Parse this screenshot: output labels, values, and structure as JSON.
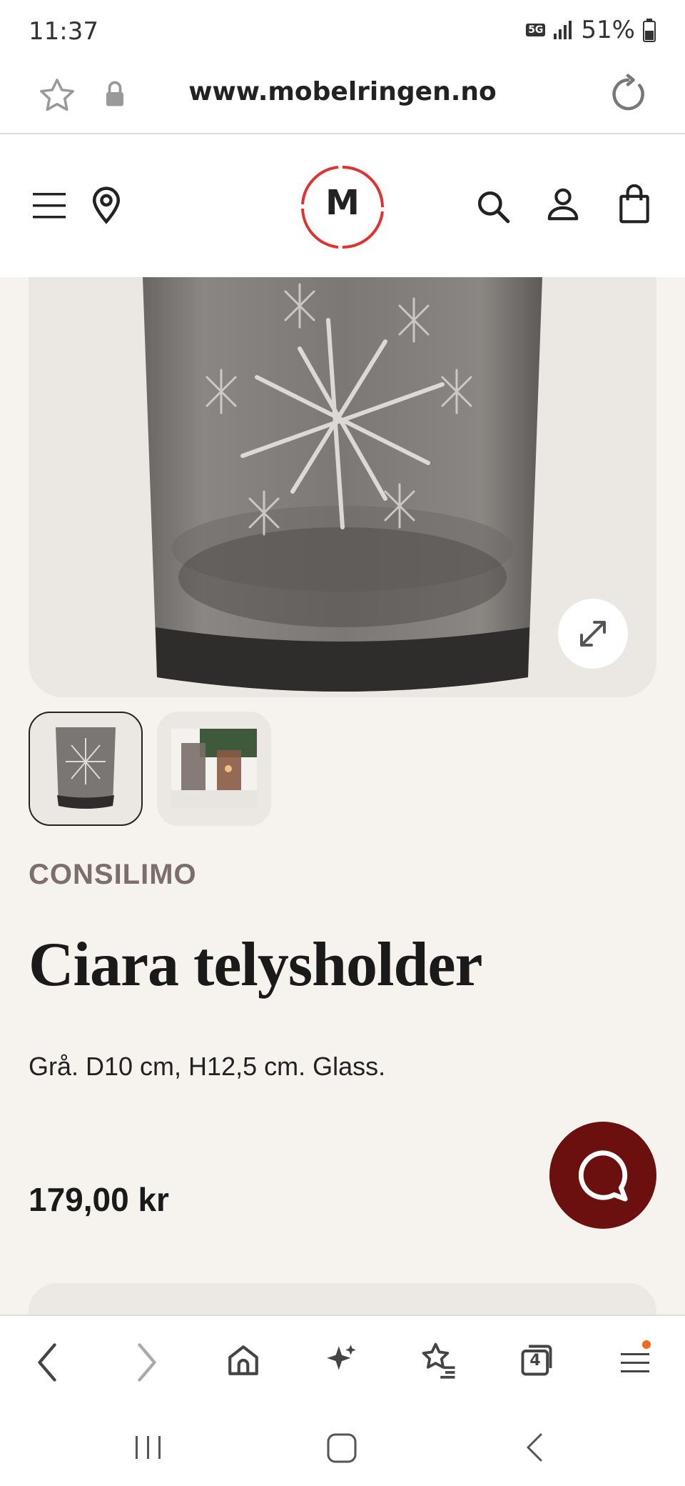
{
  "status": {
    "time": "11:37",
    "network": "5G",
    "battery": "51%"
  },
  "browser": {
    "url": "www.mobelringen.no",
    "tab_count": "4"
  },
  "header": {
    "logo_letter": "M"
  },
  "product": {
    "brand": "CONSILIMO",
    "title": "Ciara telysholder",
    "description": "Grå. D10 cm, H12,5 cm. Glass.",
    "price": "179,00 kr"
  },
  "colors": {
    "accent": "#e0322f",
    "chat": "#6b0f0f",
    "background": "#f6f2ee"
  },
  "icons": [
    "star-icon",
    "lock-icon",
    "reload-icon",
    "menu-icon",
    "location-icon",
    "search-icon",
    "account-icon",
    "bag-icon",
    "expand-icon",
    "chat-icon",
    "back-icon",
    "forward-icon",
    "home-icon",
    "sparkle-icon",
    "bookmarks-icon",
    "tabs-icon",
    "browser-menu-icon"
  ]
}
